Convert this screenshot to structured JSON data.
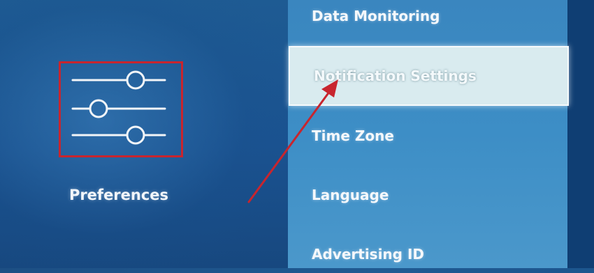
{
  "left": {
    "label": "Preferences",
    "icon": "sliders-icon"
  },
  "menu": {
    "items": [
      {
        "label": "Data Monitoring",
        "selected": false
      },
      {
        "label": "Notification Settings",
        "selected": true
      },
      {
        "label": "Time Zone",
        "selected": false
      },
      {
        "label": "Language",
        "selected": false
      },
      {
        "label": "Advertising ID",
        "selected": false
      }
    ]
  },
  "annotation": {
    "frame_color": "#c8252e",
    "arrow_color": "#c8252e"
  },
  "colors": {
    "left_background": "#1a5290",
    "menu_background": "#3d8ec6",
    "selected_background": "#d9ebef",
    "text": "#f5f8fb"
  }
}
